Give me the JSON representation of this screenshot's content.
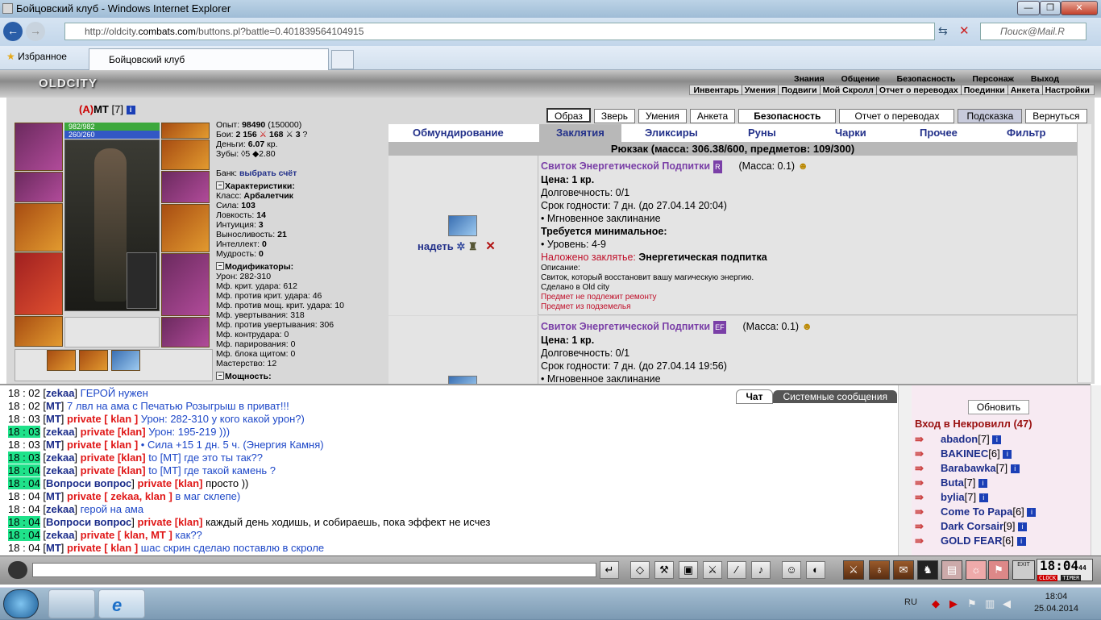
{
  "window": {
    "title": "Бойцовский клуб - Windows Internet Explorer",
    "min": "—",
    "max": "❐",
    "close": "✕"
  },
  "addressbar": {
    "url_pre": "http://oldcity.",
    "url_host": "combats.com",
    "url_post": "/buttons.pl?battle=0.401839564104915",
    "search_placeholder": "Поиск@Mail.R"
  },
  "favorites": {
    "label": "Избранное"
  },
  "tab": {
    "title": "Бойцовский клуб"
  },
  "game": {
    "logo": "OLDCITY",
    "menu_top": [
      "Знания",
      "Общение",
      "Безопасность",
      "Персонаж",
      "Выход"
    ],
    "menu_sub": [
      "Инвентарь",
      "Умения",
      "Подвиги",
      "Мой Скролл",
      "Отчет о переводах",
      "Поединки",
      "Анкета",
      "Настройки"
    ]
  },
  "character": {
    "align_mark": "A",
    "name": "МТ",
    "level": "[7]",
    "hp": "982/982",
    "mp": "260/260",
    "stats": {
      "exp_label": "Опыт:",
      "exp": "98490",
      "exp_next": "(150000)",
      "fights_label": "Бои:",
      "fights_win": "2 156",
      "fights_lose": "168",
      "fights_draw": "3",
      "money_label": "Деньги:",
      "money": "6.07",
      "money_unit": "кр.",
      "teeth_label": "Зубы:",
      "teeth": "5",
      "teeth2": "2.80",
      "bank_label": "Банк:",
      "bank_link": "выбрать счёт",
      "char_header": "Характеристики:",
      "class_label": "Класс:",
      "class": "Арбалетчик",
      "str_label": "Сила:",
      "str": "103",
      "agi_label": "Ловкость:",
      "agi": "14",
      "int_label": "Интуиция:",
      "intu": "3",
      "end_label": "Выносливость:",
      "end": "21",
      "intel_label": "Интеллект:",
      "intel": "0",
      "wis_label": "Мудрость:",
      "wis": "0",
      "mod_header": "Модификаторы:",
      "dmg_label": "Урон:",
      "dmg": "282-310",
      "crit_label": "Мф. крит. удара:",
      "crit": "612",
      "acrit_label": "Мф. против крит. удара:",
      "acrit": "46",
      "apcrit_label": "Мф. против мощ. крит. удара:",
      "apcrit": "10",
      "dodge_label": "Мф. увертывания:",
      "dodge": "318",
      "adodge_label": "Мф. против увертывания:",
      "adodge": "306",
      "counter_label": "Мф. контрудара:",
      "counter": "0",
      "parry_label": "Мф. парирования:",
      "parry": "0",
      "block_label": "Мф. блока щитом:",
      "block": "0",
      "mastery_label": "Мастерство:",
      "mastery": "12",
      "power_header": "Мощность:"
    }
  },
  "toolbar": [
    "Образ",
    "Зверь",
    "Умения",
    "Анкета",
    "Безопасность",
    "Отчет о переводах",
    "Подсказка",
    "Вернуться"
  ],
  "inv_tabs": [
    "Обмундирование",
    "Заклятия",
    "Эликсиры",
    "Руны",
    "Чарки",
    "Прочее",
    "Фильтр"
  ],
  "backpack": "Рюкзак (масса: 306.38/600, предметов: 109/300)",
  "items": [
    {
      "action": "надеть",
      "name": "Свиток Энергетической Подпитки",
      "badge": "R",
      "mass": "(Масса: 0.1)",
      "price": "Цена: 1 кр.",
      "durability": "Долговечность: 0/1",
      "expiry": "Срок годности: 7 дн. (до 27.04.14 20:04)",
      "instant": "• Мгновенное заклинание",
      "req_header": "Требуется минимальное:",
      "req_level": "• Уровень: 4-9",
      "spell_label": "Наложено заклятье:",
      "spell_name": "Энергетическая подпитка",
      "desc_label": "Описание:",
      "desc": "Свиток, который восстановит вашу магическую энергию.",
      "made": "Сделано в Old city",
      "norepair": "Предмет не подлежит ремонту",
      "dungeon": "Предмет из подземелья"
    },
    {
      "name": "Свиток Энергетической Подпитки",
      "badge": "EF",
      "mass": "(Масса: 0.1)",
      "price": "Цена: 1 кр.",
      "durability": "Долговечность: 0/1",
      "expiry": "Срок годности: 7 дн. (до 27.04.14 19:56)",
      "instant": "• Мгновенное заклинание"
    }
  ],
  "chat": {
    "tab_chat": "Чат",
    "tab_system": "Системные сообщения",
    "lines": [
      {
        "t": "18 : 02",
        "n": "zekaa",
        "p": "",
        "m": "ГЕРОЙ нужен",
        "hl": false,
        "mc": "cb"
      },
      {
        "t": "18 : 02",
        "n": "МТ",
        "p": "",
        "m": "7 лвл на ама с Печатью Розыгрыш в приват!!!",
        "hl": false,
        "mc": "cb"
      },
      {
        "t": "18 : 03",
        "n": "МТ",
        "p": "private [ klan ]",
        "m": "Урон: 282-310 у кого какой урон?)",
        "hl": false,
        "mc": "cb"
      },
      {
        "t": "18 : 03",
        "n": "zekaa",
        "p": "private [klan]",
        "m": "Урон: 195-219 )))",
        "hl": true,
        "mc": "cb"
      },
      {
        "t": "18 : 03",
        "n": "МТ",
        "p": "private [ klan ]",
        "m": "• Сила +15 1 дн. 5 ч. (Энергия Камня)",
        "hl": false,
        "mc": "cb"
      },
      {
        "t": "18 : 03",
        "n": "zekaa",
        "p": "private [klan]",
        "m": "to [МТ] где это ты так??",
        "hl": true,
        "mc": "cb"
      },
      {
        "t": "18 : 04",
        "n": "zekaa",
        "p": "private [klan]",
        "m": "to [МТ] где такой камень ?",
        "hl": true,
        "mc": "cb"
      },
      {
        "t": "18 : 04",
        "n": "Вопроси вопрос",
        "p": "private [klan]",
        "m": "просто ))",
        "hl": true,
        "mc": "t"
      },
      {
        "t": "18 : 04",
        "n": "МТ",
        "p": "private [ zekaa, klan ]",
        "m": "в маг склепе)",
        "hl": false,
        "mc": "cb"
      },
      {
        "t": "18 : 04",
        "n": "zekaa",
        "p": "",
        "m": "герой на ама",
        "hl": false,
        "mc": "cb"
      },
      {
        "t": "18 : 04",
        "n": "Вопроси вопрос",
        "p": "private [klan]",
        "m": "каждый день ходишь, и собираешь, пока эффект не исчез",
        "hl": true,
        "mc": "t"
      },
      {
        "t": "18 : 04",
        "n": "zekaa",
        "p": "private [ klan, MT ]",
        "m": "как??",
        "hl": true,
        "mc": "cb"
      },
      {
        "t": "18 : 04",
        "n": "МТ",
        "p": "private [ klan ]",
        "m": "шас скрин сделаю поставлю в скроле",
        "hl": false,
        "mc": "cb"
      }
    ]
  },
  "online": {
    "refresh": "Обновить",
    "title": "Вход в Некровилл (47)",
    "users": [
      {
        "name": "abadon",
        "lvl": "[7]"
      },
      {
        "name": "BAKINEC",
        "lvl": "[6]"
      },
      {
        "name": "Barabawka",
        "lvl": "[7]"
      },
      {
        "name": "Buta",
        "lvl": "[7]"
      },
      {
        "name": "bylia",
        "lvl": "[7]"
      },
      {
        "name": "Come To Papa",
        "lvl": "[6]"
      },
      {
        "name": "Dark Corsair",
        "lvl": "[9]"
      },
      {
        "name": "GOLD FEAR",
        "lvl": "[6]"
      }
    ]
  },
  "clock": {
    "time": "18:04",
    "sec": "44",
    "lbl1": "CLOCK",
    "lbl2": "TIMER",
    "exit": "EXIT"
  },
  "taskbar": {
    "lang": "RU",
    "time": "18:04",
    "date": "25.04.2014"
  }
}
